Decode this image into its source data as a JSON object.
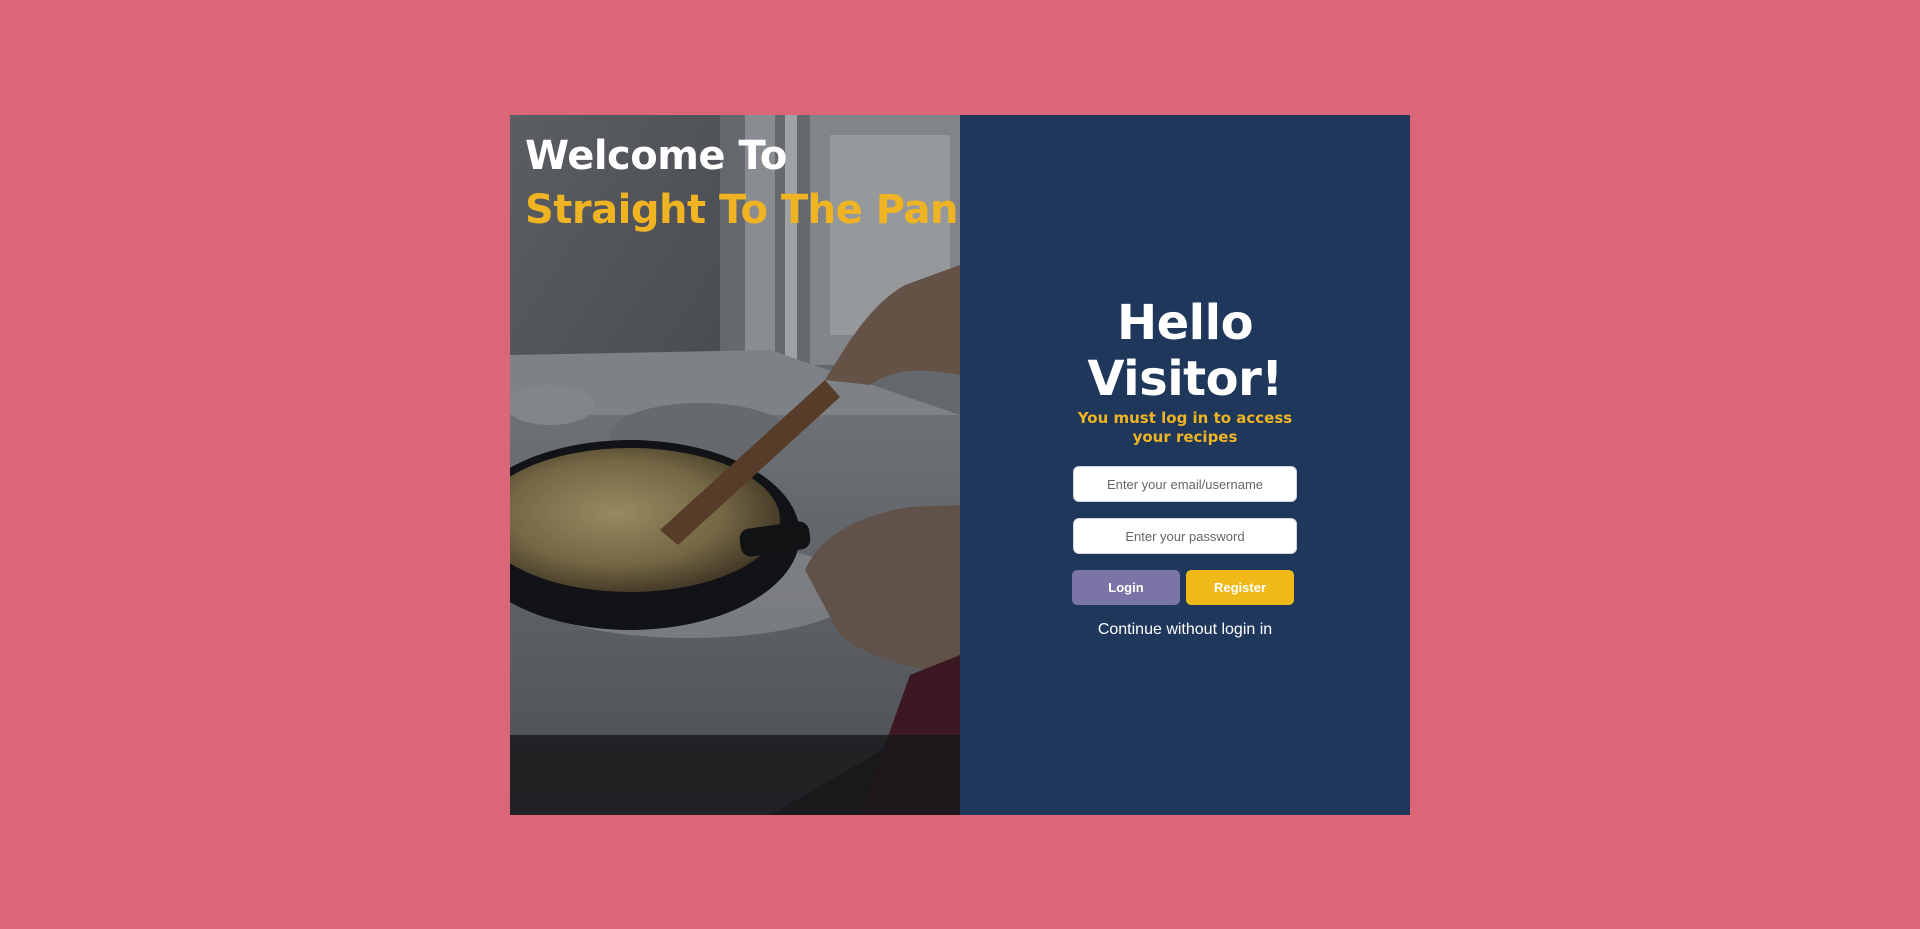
{
  "hero": {
    "line1": "Welcome To",
    "line2": "Straight To The Pan"
  },
  "login": {
    "greeting": "Hello Visitor!",
    "subtitle": "You must log in to access your recipes",
    "email_placeholder": "Enter your email/username",
    "password_placeholder": "Enter your password",
    "login_label": "Login",
    "register_label": "Register",
    "continue_label": "Continue without login in"
  },
  "colors": {
    "page_background": "#db6677",
    "panel_background": "#1e375b",
    "accent_yellow": "#f0b322",
    "login_button": "#7b74a6",
    "register_button": "#f0b91a"
  }
}
